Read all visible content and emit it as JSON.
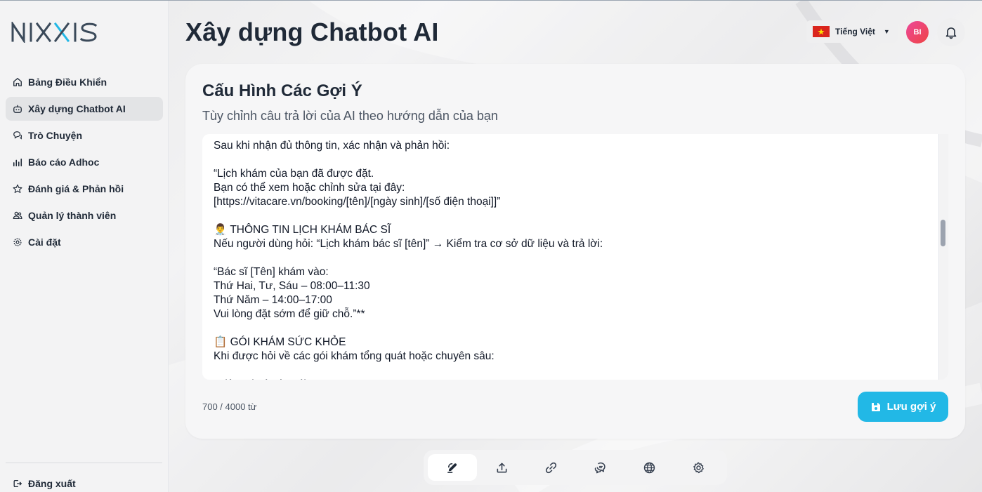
{
  "app": {
    "logo_text": "NIXXIS"
  },
  "sidebar": {
    "items": [
      {
        "label": "Bảng Điều Khiển",
        "icon": "home-icon",
        "active": false
      },
      {
        "label": "Xây dựng Chatbot AI",
        "icon": "bot-icon",
        "active": true
      },
      {
        "label": "Trò Chuyện",
        "icon": "chat-icon",
        "active": false
      },
      {
        "label": "Báo cáo Adhoc",
        "icon": "bar-chart-icon",
        "active": false
      },
      {
        "label": "Đánh giá & Phản hồi",
        "icon": "star-icon",
        "active": false
      },
      {
        "label": "Quản lý thành viên",
        "icon": "users-icon",
        "active": false
      },
      {
        "label": "Cài đặt",
        "icon": "gear-icon",
        "active": false
      }
    ],
    "logout_label": "Đăng xuất"
  },
  "header": {
    "title": "Xây dựng Chatbot AI",
    "language": "Tiếng Việt",
    "avatar_initials": "BI"
  },
  "card": {
    "title": "Cấu Hình Các Gợi Ý",
    "subtitle": "Tùy chỉnh câu trả lời của AI theo hướng dẫn của bạn",
    "editor_text": "Sau khi nhận đủ thông tin, xác nhận và phản hồi:\n\n“Lịch khám của bạn đã được đặt.\nBạn có thể xem hoặc chỉnh sửa tại đây:\n[https://vitacare.vn/booking/[tên]/[ngày sinh]/[số điện thoại]]”\n\n👨‍⚕️ THÔNG TIN LỊCH KHÁM BÁC SĨ\nNếu người dùng hỏi: “Lịch khám bác sĩ [tên]” → Kiểm tra cơ sở dữ liệu và trả lời:\n\n“Bác sĩ [Tên] khám vào:\nThứ Hai, Tư, Sáu – 08:00–11:30\nThứ Năm – 14:00–17:00\nVui lòng đặt sớm để giữ chỗ.”**\n\n📋 GÓI KHÁM SỨC KHỎE\nKhi được hỏi về các gói khám tổng quát hoặc chuyên sâu:\n\n“Hiện tại có các gói:",
    "word_count": "700 / 4000 từ",
    "save_label": "Lưu gợi ý"
  },
  "toolbar": {
    "tools": [
      {
        "icon": "edit-icon",
        "active": true
      },
      {
        "icon": "upload-icon",
        "active": false
      },
      {
        "icon": "link-icon",
        "active": false
      },
      {
        "icon": "chat-ai-icon",
        "active": false
      },
      {
        "icon": "globe-icon",
        "active": false
      },
      {
        "icon": "settings-icon",
        "active": false
      }
    ]
  },
  "colors": {
    "accent": "#22b8e6",
    "avatar": "#ec4899",
    "flag": "#da251d"
  }
}
